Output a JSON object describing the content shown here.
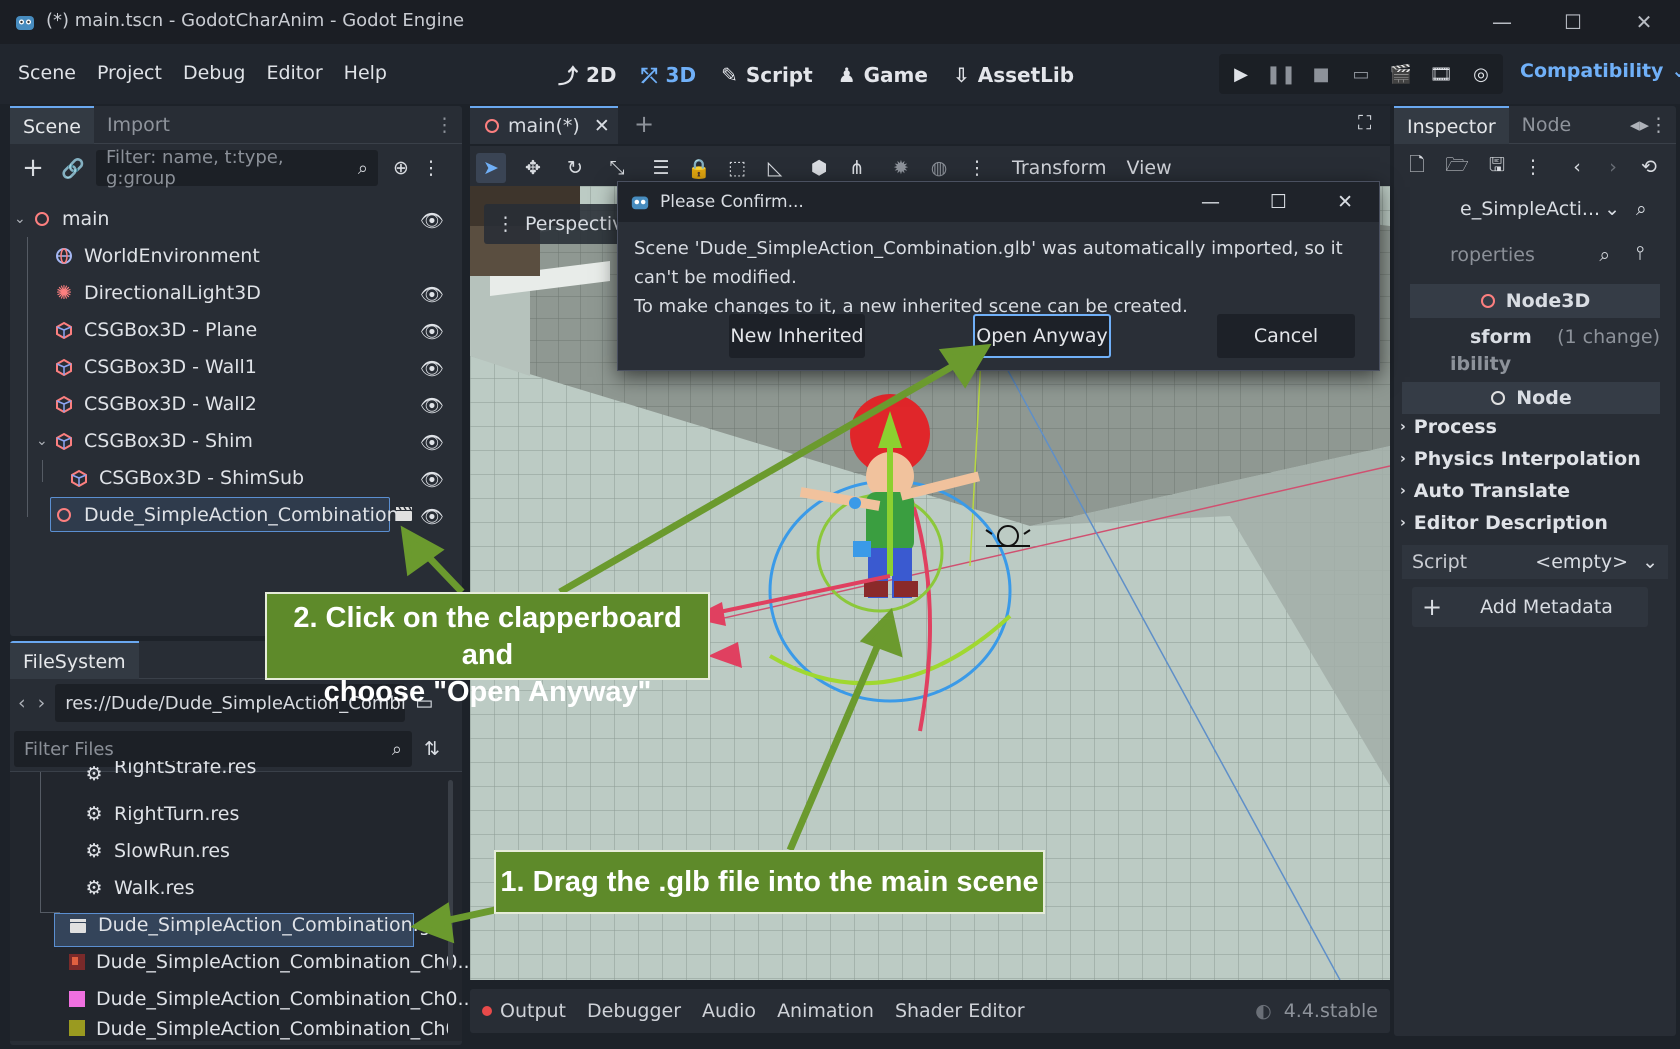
{
  "window": {
    "title": "(*) main.tscn - GodotCharAnim - Godot Engine"
  },
  "menu": [
    "Scene",
    "Project",
    "Debug",
    "Editor",
    "Help"
  ],
  "workspaces": [
    {
      "label": "2D",
      "icon": "2d-icon"
    },
    {
      "label": "3D",
      "icon": "3d-icon",
      "active": true
    },
    {
      "label": "Script",
      "icon": "script-icon"
    },
    {
      "label": "Game",
      "icon": "game-icon"
    },
    {
      "label": "AssetLib",
      "icon": "assetlib-icon"
    }
  ],
  "renderer": "Compatibility",
  "scene_dock": {
    "tabs": [
      "Scene",
      "Import"
    ],
    "filter_placeholder": "Filter: name, t:type, g:group",
    "tree": [
      {
        "label": "main",
        "icon": "node3d-icon"
      },
      {
        "label": "WorldEnvironment",
        "icon": "world-environment-icon"
      },
      {
        "label": "DirectionalLight3D",
        "icon": "directional-light-icon"
      },
      {
        "label": "CSGBox3D - Plane",
        "icon": "csg-box-icon"
      },
      {
        "label": "CSGBox3D - Wall1",
        "icon": "csg-box-icon"
      },
      {
        "label": "CSGBox3D - Wall2",
        "icon": "csg-box-icon"
      },
      {
        "label": "CSGBox3D - Shim",
        "icon": "csg-box-icon"
      },
      {
        "label": "CSGBox3D - ShimSub",
        "icon": "csg-box-icon"
      },
      {
        "label": "Dude_SimpleAction_Combination",
        "icon": "node3d-icon"
      }
    ]
  },
  "filesystem": {
    "tab": "FileSystem",
    "path": "res://Dude/Dude_SimpleAction_Combi",
    "filter_placeholder": "Filter Files",
    "files": [
      {
        "label": "RightStrafe.res",
        "icon": "animation-icon"
      },
      {
        "label": "RightTurn.res",
        "icon": "animation-icon"
      },
      {
        "label": "SlowRun.res",
        "icon": "animation-icon"
      },
      {
        "label": "Walk.res",
        "icon": "animation-icon"
      },
      {
        "label": "Dude_SimpleAction_Combination.glb",
        "icon": "scene-clapper-icon"
      },
      {
        "label": "Dude_SimpleAction_Combination_Ch0...",
        "icon": "texture-icon"
      },
      {
        "label": "Dude_SimpleAction_Combination_Ch0...",
        "icon": "texture-icon"
      },
      {
        "label": "Dude_SimpleAction_Combination_Ch0...",
        "icon": "texture-icon"
      }
    ]
  },
  "editor_tab": {
    "label": "main(*)"
  },
  "viewport_toolbar": {
    "transform": "Transform",
    "view": "View",
    "perspective": "Perspective"
  },
  "dialog": {
    "title": "Please Confirm...",
    "message_line1": "Scene 'Dude_SimpleAction_Combination.glb' was automatically imported, so it can't be modified.",
    "message_line2": "To make changes to it, a new inherited scene can be created.",
    "buttons": [
      "New Inherited",
      "Open Anyway",
      "Cancel"
    ]
  },
  "callouts": {
    "step1": "1. Drag the .glb file into the main scene",
    "step2_line1": "2. Click on the clapperboard and",
    "step2_line2": "choose \"Open Anyway\""
  },
  "inspector": {
    "tabs": [
      "Inspector",
      "Node"
    ],
    "object": "e_SimpleActi...",
    "filter_placeholder": "roperties",
    "class_node3d": "Node3D",
    "transform_label": "sform",
    "transform_change": "(1 change)",
    "visibility": "ibility",
    "class_node": "Node",
    "sections": [
      "Process",
      "Physics Interpolation",
      "Auto Translate",
      "Editor Description"
    ],
    "script_label": "Script",
    "script_value": "<empty>",
    "add_metadata": "Add Metadata"
  },
  "bottom_panel": {
    "tabs": [
      "Output",
      "Debugger",
      "Audio",
      "Animation",
      "Shader Editor"
    ],
    "version": "4.4.stable"
  },
  "colors": {
    "accent": "#70b0f8",
    "callout": "#5e8a2a",
    "node3d": "#fc7f7f"
  }
}
